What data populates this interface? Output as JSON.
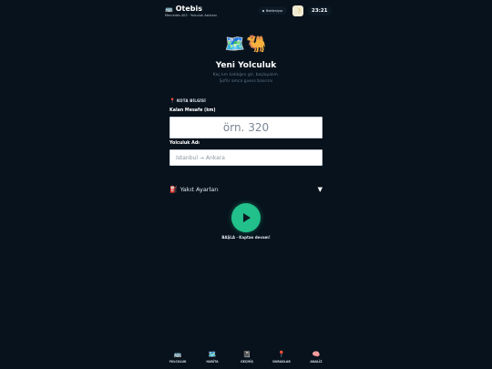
{
  "header": {
    "brand": "Otebis",
    "brand_icon": "bus-icon",
    "subtitle": "Mercedes 403 · Yolculuk Asistanı",
    "status": "Bekleniyor",
    "theme_icon": "moon-icon",
    "clock": "23:21"
  },
  "hero": {
    "icons": "🗺️🐫",
    "title": "Yeni Yolculuk",
    "desc_line1": "Kaç km kaldığını gir, başlayalım.",
    "desc_line2": "Şoför amca guess basıcını"
  },
  "form": {
    "section_label": "KOTA BİLGİSİ",
    "distance_label": "Kalan Mesafe (km)",
    "distance_placeholder": "örn. 320",
    "distance_value": "",
    "name_label": "Yolculuk Adı",
    "name_placeholder": "İstanbul → Ankara",
    "name_value": ""
  },
  "fuel": {
    "label": "Yakıt Ayarları",
    "icon": "fuel-pump-icon",
    "expanded": false
  },
  "start": {
    "caption": "BAŞLA · Kaptan devam!"
  },
  "nav": {
    "items": [
      {
        "label": "YOLCULUK",
        "icon": "🚌"
      },
      {
        "label": "HARİTA",
        "icon": "🗺️"
      },
      {
        "label": "GEÇMİŞ",
        "icon": "📓"
      },
      {
        "label": "DURAKLAR",
        "icon": "📍"
      },
      {
        "label": "ANALİZ",
        "icon": "🧠"
      }
    ]
  },
  "colors": {
    "background": "#07121c",
    "accent": "#22c08a",
    "pin": "#e24c4b"
  }
}
